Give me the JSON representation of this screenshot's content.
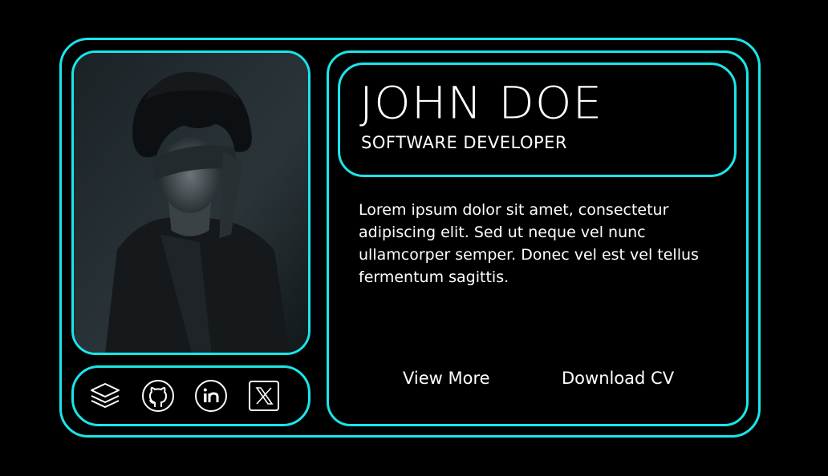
{
  "profile": {
    "name": "JOHN DOE",
    "role": "SOFTWARE DEVELOPER",
    "bio": "Lorem ipsum dolor sit amet, consectetur adipiscing elit. Sed ut neque vel nunc ullamcorper semper. Donec vel est vel tellus fermentum sagittis."
  },
  "actions": {
    "view_more": "View More",
    "download_cv": "Download CV"
  },
  "social": [
    {
      "icon": "layers-icon"
    },
    {
      "icon": "github-icon"
    },
    {
      "icon": "linkedin-icon"
    },
    {
      "icon": "x-icon"
    }
  ],
  "colors": {
    "accent": "#19e6ea",
    "background": "#000000",
    "text": "#ffffff"
  }
}
